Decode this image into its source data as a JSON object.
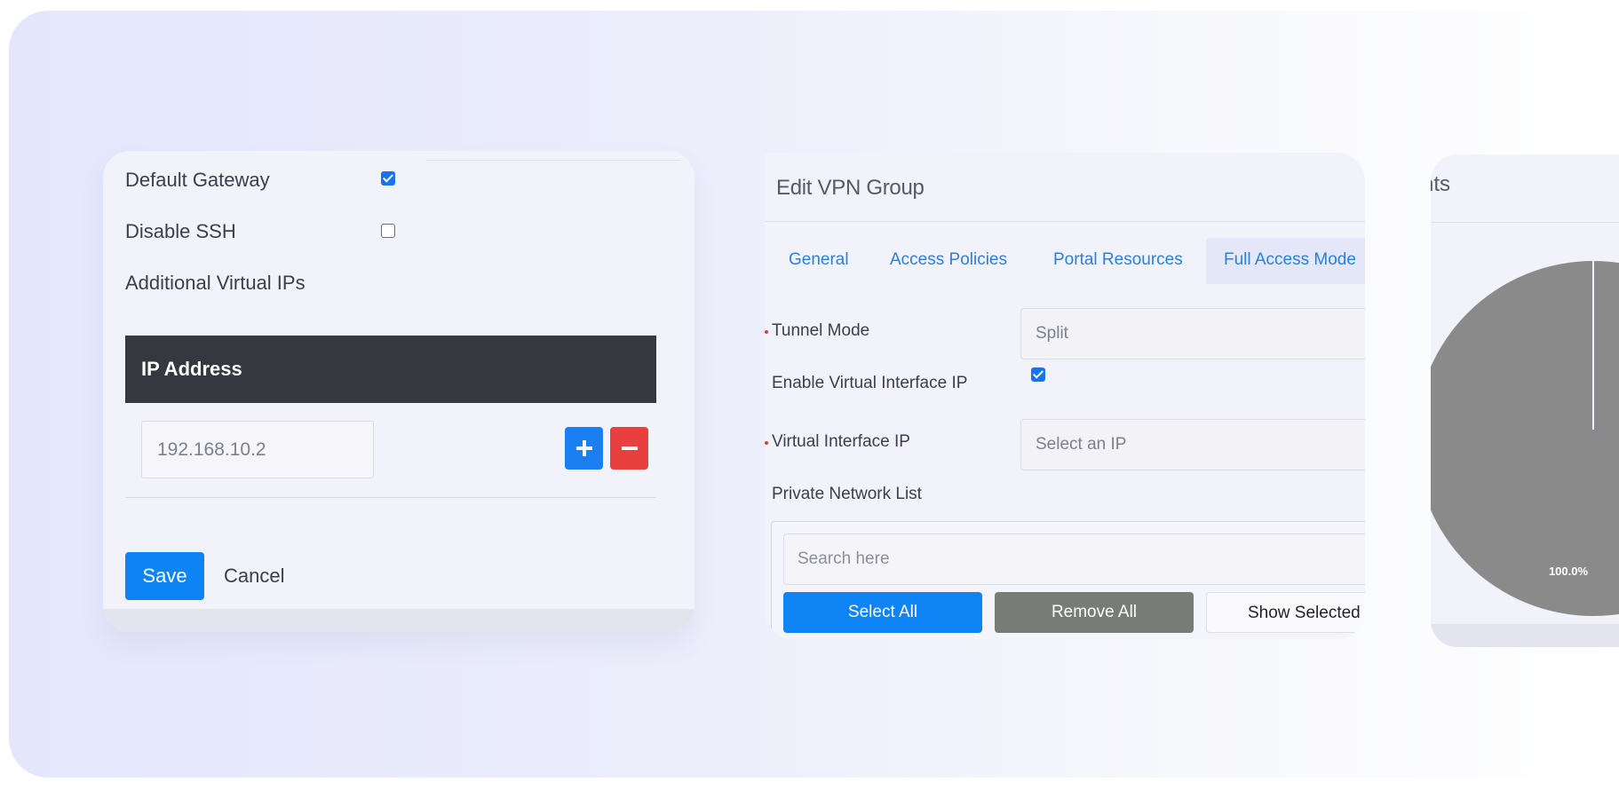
{
  "gateway_form": {
    "default_gateway_label": "Default Gateway",
    "default_gateway_checked": true,
    "disable_ssh_label": "Disable SSH",
    "disable_ssh_checked": false,
    "additional_ips_label": "Additional Virtual IPs",
    "ip_column_header": "IP Address",
    "ip_value": "192.168.10.2",
    "add_icon": "plus-icon",
    "remove_icon": "minus-icon",
    "save_label": "Save",
    "cancel_label": "Cancel"
  },
  "vpn_group": {
    "title": "Edit VPN Group",
    "tabs": [
      {
        "label": "General",
        "active": false
      },
      {
        "label": "Access Policies",
        "active": false
      },
      {
        "label": "Portal Resources",
        "active": false
      },
      {
        "label": "Full Access Mode",
        "active": true
      }
    ],
    "tunnel_mode_label": "Tunnel Mode",
    "tunnel_mode_value": "Split",
    "enable_vip_label": "Enable Virtual Interface IP",
    "enable_vip_checked": true,
    "vip_label": "Virtual Interface IP",
    "vip_placeholder": "Select an IP",
    "private_network_label": "Private Network List",
    "search_placeholder": "Search here",
    "select_all_label": "Select All",
    "remove_all_label": "Remove All",
    "show_selected_label": "Show Selected"
  },
  "chart_panel": {
    "title_fragment": "nts"
  },
  "chart_data": {
    "type": "pie",
    "title": "",
    "categories": [
      ""
    ],
    "values": [
      100.0
    ],
    "data_labels": [
      "100.0%"
    ],
    "colors": [
      "#8a8a8a"
    ]
  },
  "colors": {
    "primary": "#0d84f5",
    "danger": "#e8403f",
    "header_dark": "#35383f",
    "remove_gray": "#777c76",
    "tab_link": "#2d7fd6"
  }
}
